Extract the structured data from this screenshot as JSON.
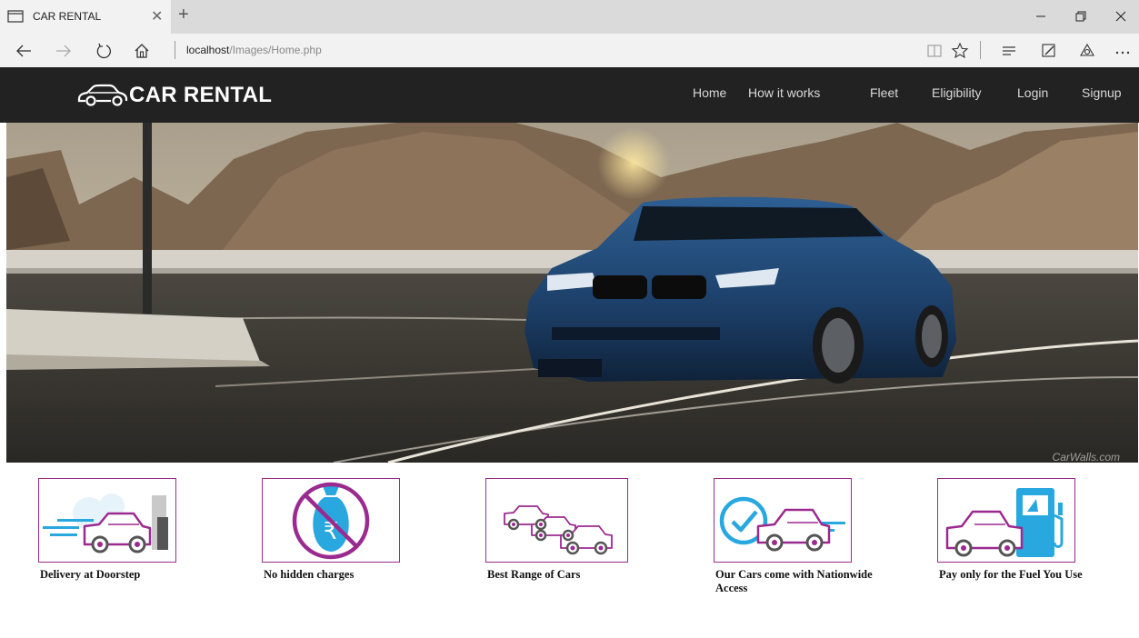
{
  "browser": {
    "tab_title": "CAR RENTAL",
    "url_host": "localhost",
    "url_path": "/Images/Home.php"
  },
  "site": {
    "logo_text": "CAR RENTAL",
    "nav": [
      {
        "label": "Home"
      },
      {
        "label": "How it works"
      },
      {
        "label": "Fleet"
      },
      {
        "label": "Eligibility"
      },
      {
        "label": "Login"
      },
      {
        "label": "Signup"
      }
    ],
    "hero_watermark": "CarWalls.com"
  },
  "features": [
    {
      "label": "Delivery at Doorstep",
      "icon": "delivery-car-icon"
    },
    {
      "label": "No hidden charges",
      "icon": "no-charges-icon"
    },
    {
      "label": "Best Range of Cars",
      "icon": "car-range-icon"
    },
    {
      "label": "Our Cars come with Nationwide Access",
      "icon": "nationwide-access-icon"
    },
    {
      "label": "Pay only for the Fuel You Use",
      "icon": "fuel-pump-icon"
    }
  ],
  "colors": {
    "header_bg": "#222222",
    "accent_magenta": "#9b2a8f",
    "icon_blue": "#29a7df"
  }
}
